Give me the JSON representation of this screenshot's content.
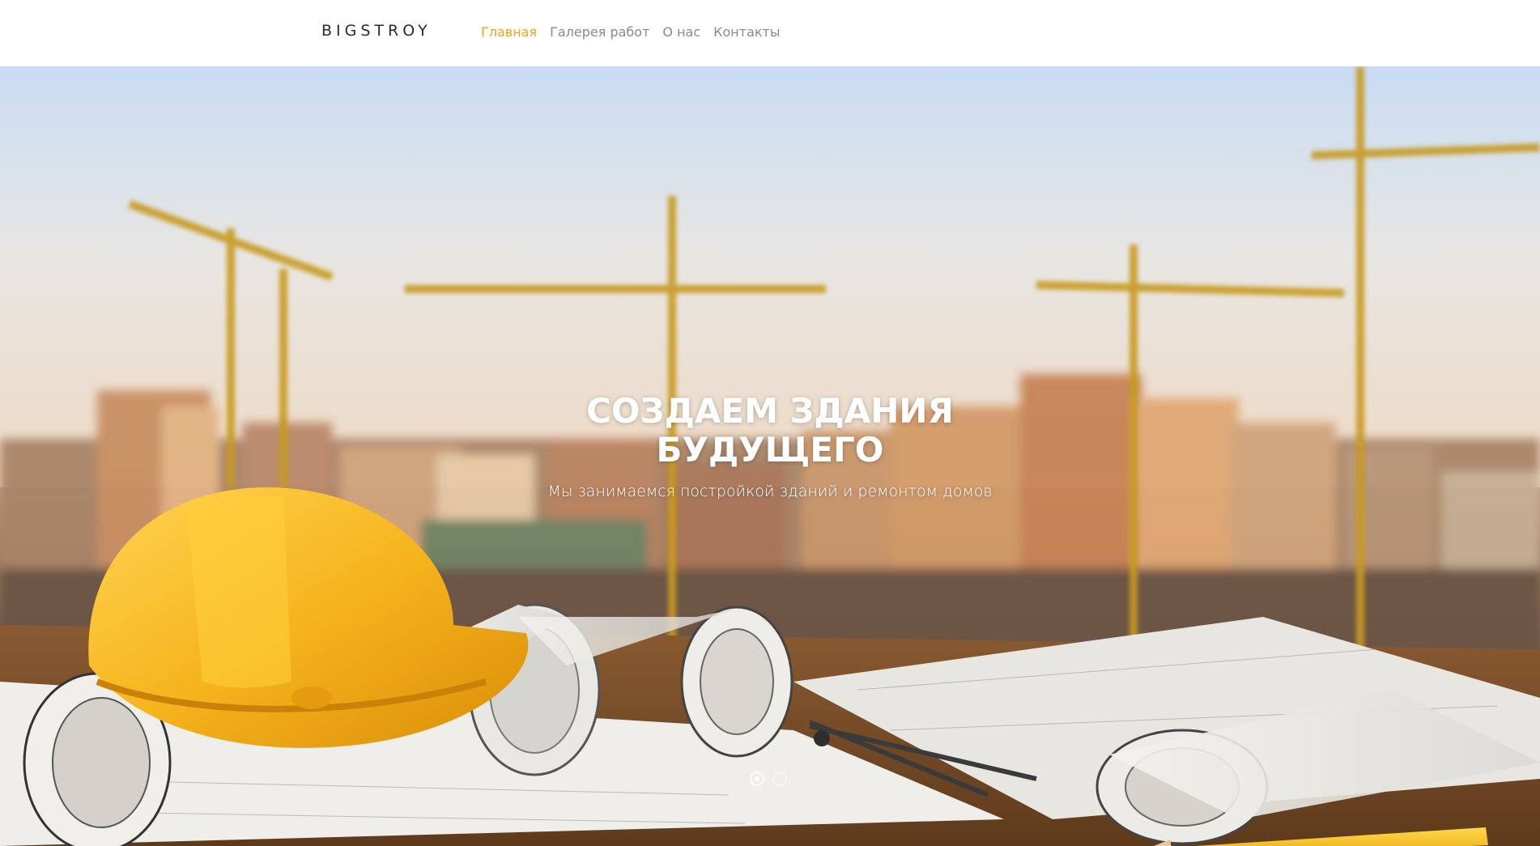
{
  "header": {
    "logo": "BIGSTROY",
    "nav": [
      {
        "label": "Главная",
        "active": true
      },
      {
        "label": "Галерея работ",
        "active": false
      },
      {
        "label": "О нас",
        "active": false
      },
      {
        "label": "Контакты",
        "active": false
      }
    ]
  },
  "hero": {
    "title": "Создаем здания будущего",
    "subtitle": "Мы занимаемся постройкой зданий и ремонтом домов",
    "slides_count": 2,
    "active_slide": 1
  },
  "colors": {
    "accent": "#f0a320",
    "nav_text": "#8a8a8a",
    "logo_text": "#2b2b2b",
    "hero_text": "#ffffff"
  }
}
